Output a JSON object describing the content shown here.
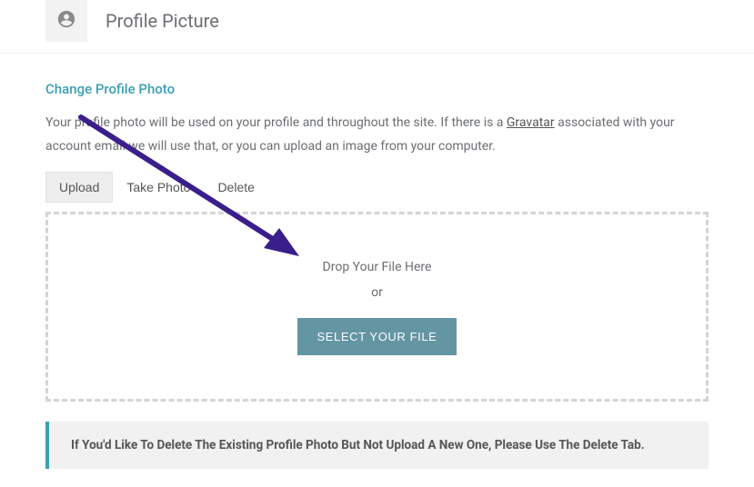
{
  "header": {
    "title": "Profile Picture"
  },
  "section": {
    "heading": "Change Profile Photo",
    "desc_before": "Your profile photo will be used on your profile and throughout the site. If there is a ",
    "desc_link": "Gravatar",
    "desc_after": " associated with your account email we will use that, or you can upload an image from your computer."
  },
  "tabs": {
    "upload": "Upload",
    "take_photo": "Take Photo",
    "delete": "Delete"
  },
  "dropzone": {
    "line1": "Drop Your File Here",
    "line2": "or",
    "button": "SELECT YOUR FILE"
  },
  "notice": {
    "text": "If You'd Like To Delete The Existing Profile Photo But Not Upload A New One, Please Use The Delete Tab."
  }
}
